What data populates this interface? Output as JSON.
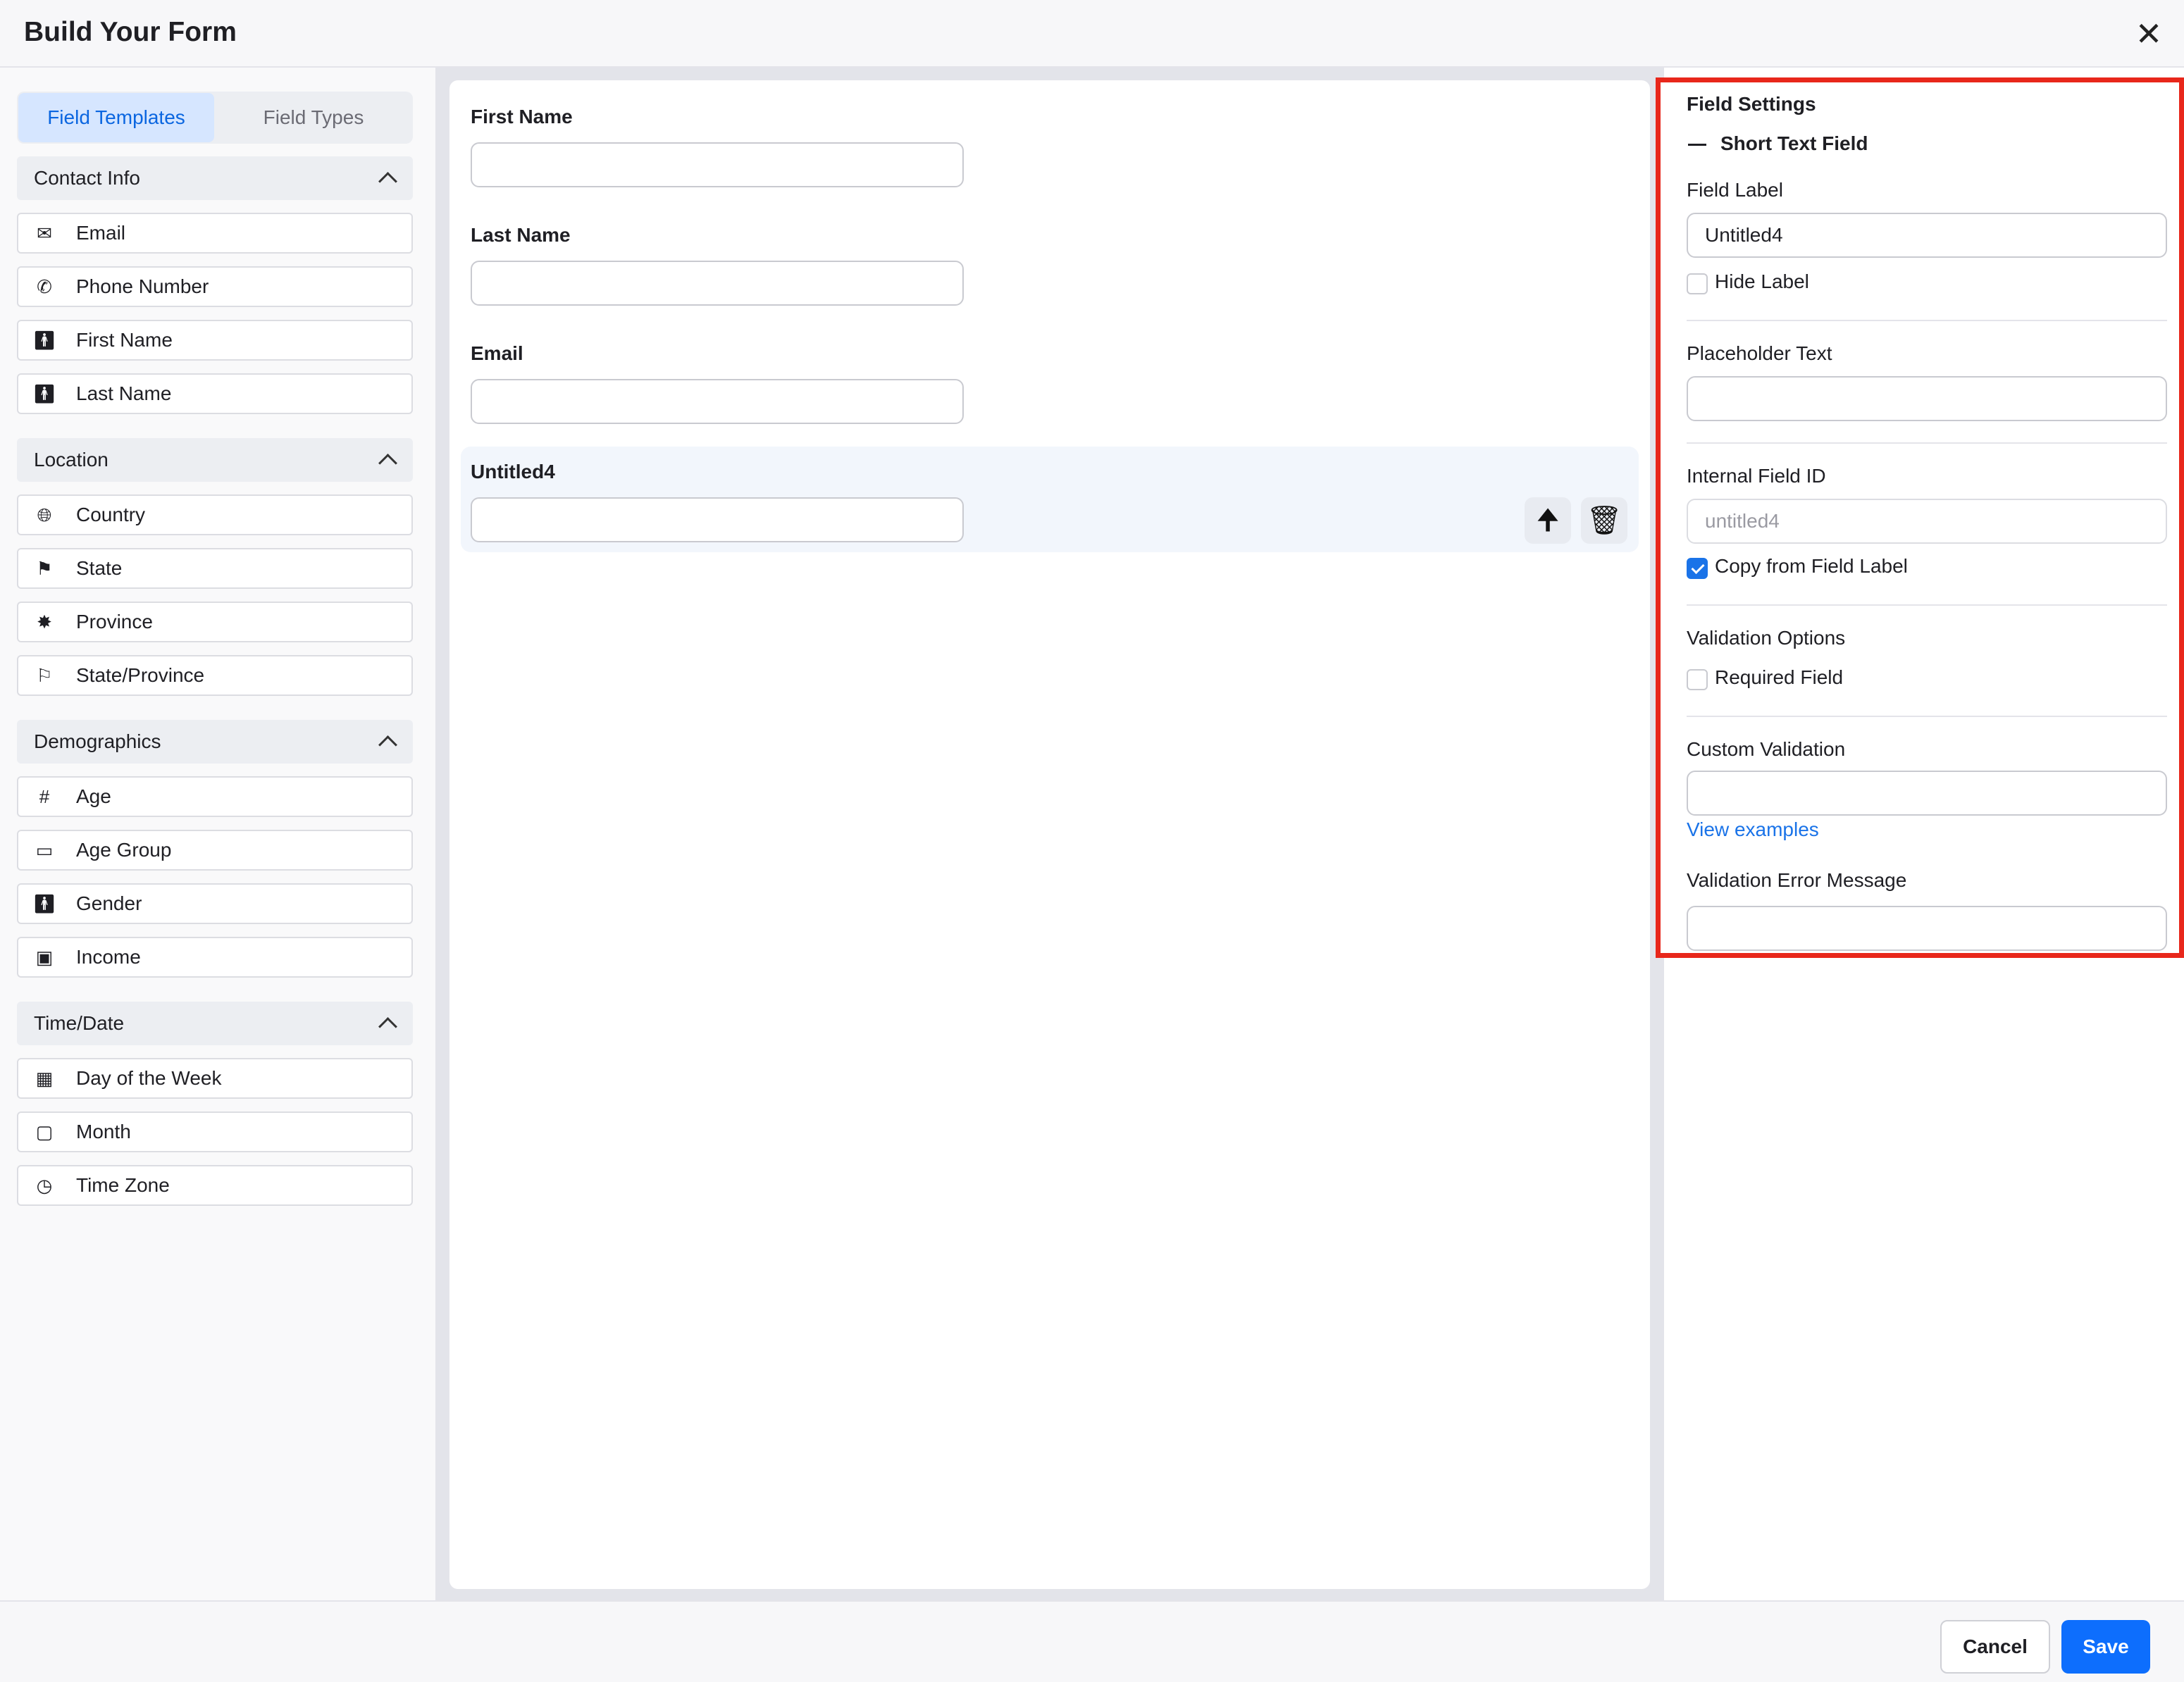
{
  "header": {
    "title": "Build Your Form",
    "close_icon": "close-icon"
  },
  "left": {
    "tabs": [
      {
        "label": "Field Templates",
        "active": true
      },
      {
        "label": "Field Types",
        "active": false
      }
    ],
    "sections": [
      {
        "label": "Contact Info",
        "items": [
          {
            "label": "Email",
            "icon": "envelope-icon"
          },
          {
            "label": "Phone Number",
            "icon": "phone-icon"
          },
          {
            "label": "First Name",
            "icon": "person-icon"
          },
          {
            "label": "Last Name",
            "icon": "person-icon"
          }
        ]
      },
      {
        "label": "Location",
        "items": [
          {
            "label": "Country",
            "icon": "globe-icon"
          },
          {
            "label": "State",
            "icon": "flag-icon"
          },
          {
            "label": "Province",
            "icon": "maple-leaf-icon"
          },
          {
            "label": "State/Province",
            "icon": "flag-outline-icon"
          }
        ]
      },
      {
        "label": "Demographics",
        "items": [
          {
            "label": "Age",
            "icon": "hash-icon"
          },
          {
            "label": "Age Group",
            "icon": "id-card-icon"
          },
          {
            "label": "Gender",
            "icon": "person-icon"
          },
          {
            "label": "Income",
            "icon": "money-icon"
          }
        ]
      },
      {
        "label": "Time/Date",
        "items": [
          {
            "label": "Day of the Week",
            "icon": "calendar-icon"
          },
          {
            "label": "Month",
            "icon": "calendar-outline-icon"
          },
          {
            "label": "Time Zone",
            "icon": "clock-icon"
          }
        ]
      }
    ]
  },
  "canvas": {
    "fields": [
      {
        "label": "First Name"
      },
      {
        "label": "Last Name"
      },
      {
        "label": "Email"
      },
      {
        "label": "Untitled4",
        "selected": true
      }
    ]
  },
  "settings": {
    "title": "Field Settings",
    "type_label": "Short Text Field",
    "field_label": "Field Label",
    "field_label_value": "Untitled4",
    "hide_label": "Hide Label",
    "placeholder_label": "Placeholder Text",
    "internal_id_label": "Internal Field ID",
    "internal_id_placeholder": "untitled4",
    "copy_label": "Copy from Field Label",
    "validation_label": "Validation Options",
    "required_label": "Required Field",
    "custom_validation_label": "Custom Validation",
    "view_examples": "View examples",
    "error_message_label": "Validation Error Message",
    "highlight_color": "#e8271b"
  },
  "footer": {
    "cancel": "Cancel",
    "save": "Save",
    "save_color": "#0d6efd"
  }
}
